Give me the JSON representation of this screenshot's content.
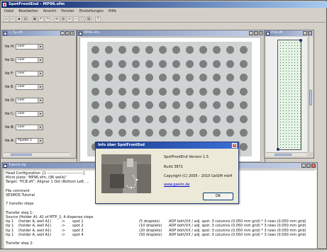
{
  "app": {
    "title": "SpotFrontEnd - MP96.sfm",
    "menu": [
      "Datei",
      "Bearbeiten",
      "Ansicht",
      "Fenster",
      "Einstellungen",
      "Hilfe"
    ],
    "toolbar_icons": [
      "new-icon",
      "open-icon",
      "save-icon",
      "print-icon",
      "grid-icon",
      "undo-icon",
      "redo-icon",
      "list-icon",
      "table-icon",
      "zoom-in-icon",
      "zoom-out-icon",
      "zoom-fit-icon",
      "chart-icon",
      "help-icon"
    ]
  },
  "left_panel": {
    "title": "3_Tip.sfh",
    "rows": [
      {
        "label": "Ite H:",
        "value": "Leer"
      },
      {
        "label": "Ite G:",
        "value": "Leer"
      },
      {
        "label": "Ite F:",
        "value": "Leer"
      },
      {
        "label": "Ite E:",
        "value": "Leer"
      },
      {
        "label": "Ite D:",
        "value": "Leer"
      },
      {
        "label": "Ite C:",
        "value": "Leer"
      },
      {
        "label": "Ite B:",
        "value": "Leer"
      },
      {
        "label": "Ite A:",
        "value": "Pipette 1"
      }
    ]
  },
  "plate_window": {
    "title": "MP96.sfm",
    "rows": 8,
    "cols": 12
  },
  "pcb_window": {
    "title": "PCB.sft"
  },
  "tutorial": {
    "title": "Tutorial.sfp",
    "lines": [
      "Head Configuration: [1 ----------------------------]",
      "Micro plate: 'MP96.sfm, (96 wells)'",
      "Target: \"PCB.sft\", Aligner 1 Dot (Bottom Left, ...",
      "",
      "File comment",
      "   SESMOS Tutorial",
      "",
      "7 transfer steps",
      "",
      "Transfer step 1:",
      "Source (Holder A): A1 of MTP_1; 4 dispense steps"
    ],
    "steps": [
      {
        "tip": "tip 1",
        "holder": "(holder A, well A1)",
        "arrow": "->",
        "spot": "spot 1",
        "droplets": "(5 droplets)",
        "desc": "ADP bdrt/VX / adj. spot: 3 columns (0.050 mm grid) * 3 rows (0.050 mm grid)"
      },
      {
        "tip": "tip 1",
        "holder": "(holder A, well A1)",
        "arrow": "->",
        "spot": "spot 2",
        "droplets": "(10 droplets)",
        "desc": "ADP bdrt/VX / adj. spot: 3 columns (0.050 mm grid) * 3 rows (0.050 mm grid)"
      },
      {
        "tip": "tip 1",
        "holder": "(holder A, well A1)",
        "arrow": "->",
        "spot": "spot 3",
        "droplets": "(20 droplets)",
        "desc": "ADP bdrt/VX / adj. spot: 3 columns (0.050 mm grid) * 3 rows (0.050 mm grid)"
      },
      {
        "tip": "tip 1",
        "holder": "(holder A, well A1)",
        "arrow": "->",
        "spot": "spot 4",
        "droplets": "(50 droplets)",
        "desc": "ADP bdrt/VX / adj. spot: 3 columns (0.050 mm grid) * 3 rows (0.050 mm grid)"
      }
    ],
    "last_line": "Transfer step 2:"
  },
  "about": {
    "title": "Info über SpotFrontEnd",
    "version": "SpotFrontEnd Version 1.5",
    "build": "Build 3871",
    "copyright": "Copyright (C) 2005 - 2010 GeSiM mbH",
    "link": "www.gesim.de",
    "ok": "OK"
  },
  "colors": {
    "title_active": "#0a246a",
    "well": "#7d7f7e",
    "plate_bg": "#d0d3d4",
    "pcb_dot": "#2d8a2d"
  }
}
